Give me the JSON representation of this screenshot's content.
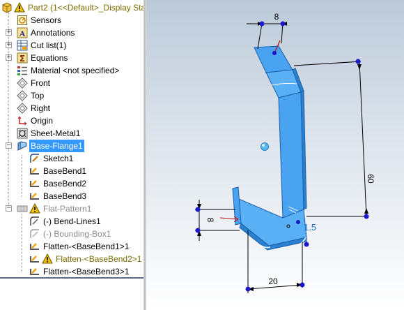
{
  "tree": {
    "root": "Part2  (1<<Default>_Display Sta",
    "items": [
      {
        "label": "Sensors"
      },
      {
        "label": "Annotations"
      },
      {
        "label": "Cut list(1)"
      },
      {
        "label": "Equations"
      },
      {
        "label": "Material <not specified>"
      },
      {
        "label": "Front"
      },
      {
        "label": "Top"
      },
      {
        "label": "Right"
      },
      {
        "label": "Origin"
      },
      {
        "label": "Sheet-Metal1"
      },
      {
        "label": "Base-Flange1"
      },
      {
        "label": "Sketch1"
      },
      {
        "label": "BaseBend1"
      },
      {
        "label": "BaseBend2"
      },
      {
        "label": "BaseBend3"
      },
      {
        "label": "Flat-Pattern1"
      },
      {
        "label": "(-) Bend-Lines1"
      },
      {
        "label": "(-) Bounding-Box1"
      },
      {
        "label": "Flatten-<BaseBend1>1"
      },
      {
        "label": "Flatten-<BaseBend2>1"
      },
      {
        "label": "Flatten-<BaseBend3>1"
      }
    ]
  },
  "dimensions": {
    "top_width": "8",
    "height": "60",
    "left_height": "8",
    "bottom_width": "20",
    "radius": "1.5"
  },
  "colors": {
    "part_blue": "#4aa3f0",
    "selection": "#3399ff",
    "warning": "#f2c200"
  }
}
